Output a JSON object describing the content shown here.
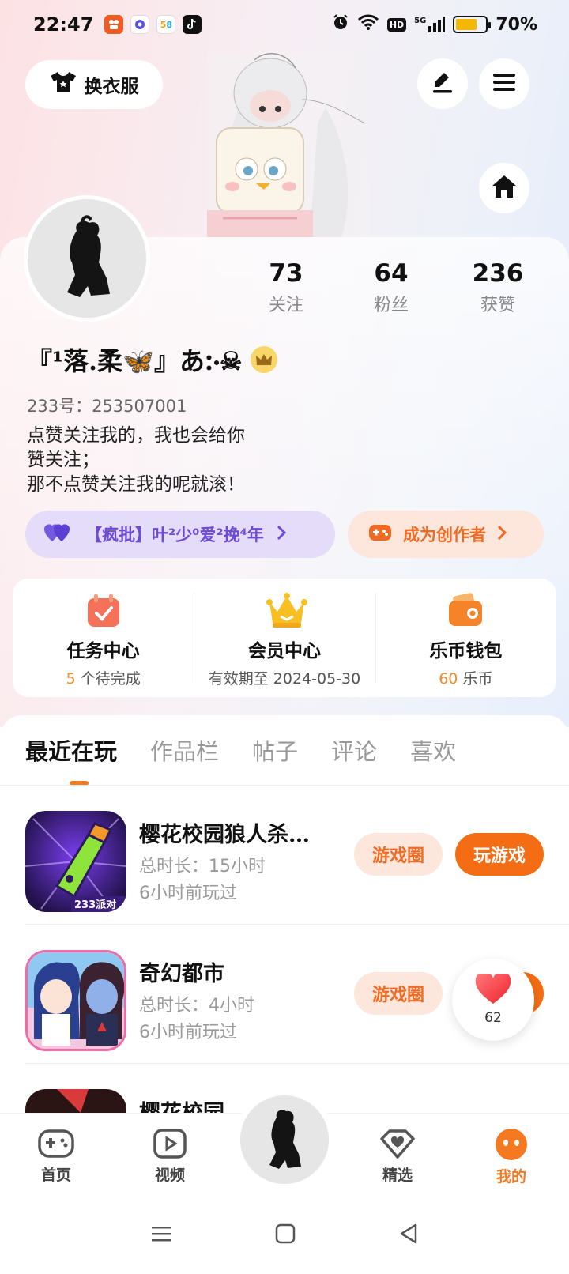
{
  "status_bar": {
    "time": "22:47",
    "battery_percent": "70%",
    "battery_level": 0.7,
    "network": "HD",
    "signal": "5G",
    "app_icons": [
      {
        "name": "kuaishou-icon",
        "color": "#f05a23"
      },
      {
        "name": "soul-icon",
        "color": "#5b4ef1"
      },
      {
        "name": "58-icon",
        "color": "#ffffff"
      },
      {
        "name": "tiktok-icon",
        "color": "#111111"
      }
    ]
  },
  "header": {
    "dress_button_label": "换衣服"
  },
  "profile": {
    "stats": [
      {
        "value": "73",
        "label": "关注"
      },
      {
        "value": "64",
        "label": "粉丝"
      },
      {
        "value": "236",
        "label": "获赞"
      }
    ],
    "nickname": "『¹落.柔🦋』あ჻☠",
    "uid": "233号：253507001",
    "bio_lines": [
      "点赞关注我的，我也会给你",
      "赞关注；",
      "那不点赞关注我的呢就滚！"
    ]
  },
  "pills": {
    "fan_group": "【疯批】叶²少⁰爱²挽⁴年",
    "creator": "成为创作者"
  },
  "quick_actions": [
    {
      "title": "任务中心",
      "sub_highlight": "5",
      "sub_text": " 个待完成"
    },
    {
      "title": "会员中心",
      "sub_highlight": "",
      "sub_text": "有效期至 2024-05-30"
    },
    {
      "title": "乐币钱包",
      "sub_highlight": "60",
      "sub_text": " 乐币"
    }
  ],
  "tabs": [
    "最近在玩",
    "作品栏",
    "帖子",
    "评论",
    "喜欢"
  ],
  "games": [
    {
      "name": "樱花校园狼人杀…",
      "duration": "总时长：15小时",
      "last_played": "6小时前玩过",
      "circle_label": "游戏圈",
      "play_label": "玩游戏",
      "badge": "233派对"
    },
    {
      "name": "奇幻都市",
      "duration": "总时长：4小时",
      "last_played": "6小时前玩过",
      "circle_label": "游戏圈"
    },
    {
      "name": "樱花校园"
    }
  ],
  "float_like": {
    "count": "62"
  },
  "bottom_nav": [
    {
      "label": "首页",
      "icon": "gamepad-icon"
    },
    {
      "label": "视频",
      "icon": "video-icon"
    },
    {
      "label": "精选",
      "icon": "heart-diamond-icon"
    },
    {
      "label": "我的",
      "icon": "profile-face-icon"
    }
  ],
  "colors": {
    "accent": "#f47920",
    "purple": "#6d4bd8",
    "orange_light": "#fde6dc"
  }
}
